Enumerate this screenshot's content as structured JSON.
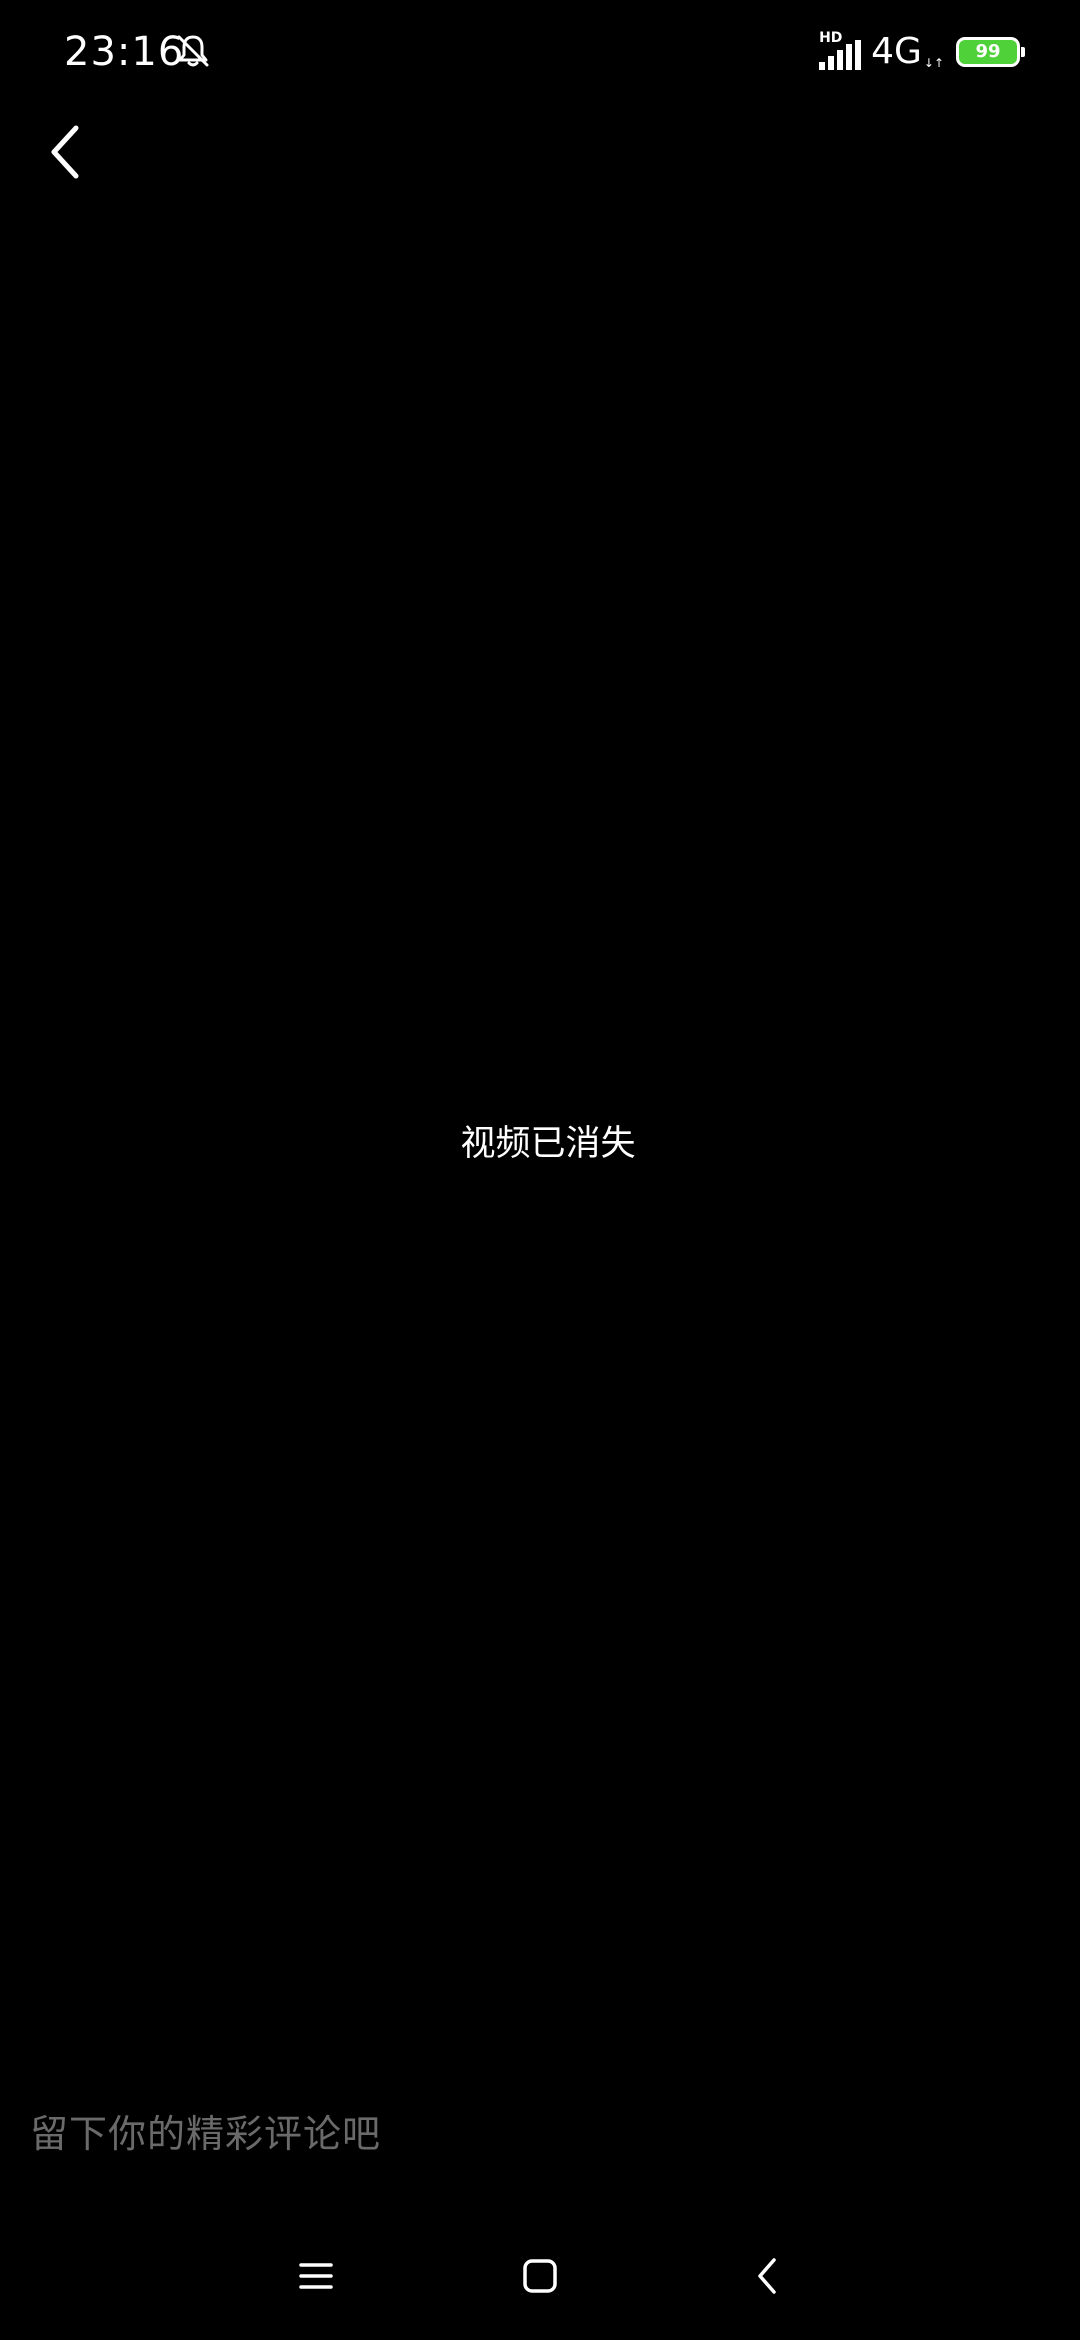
{
  "status_bar": {
    "time": "23:16",
    "hd_label": "HD",
    "network": "4G",
    "network_arrows": "↓↑",
    "battery_level": "99",
    "battery_color": "#4fd13a",
    "icons": [
      "bell-off-icon",
      "signal-icon",
      "battery-icon"
    ]
  },
  "header": {
    "back_icon": "chevron-left-icon"
  },
  "main": {
    "message": "视频已消失"
  },
  "comment": {
    "placeholder": "留下你的精彩评论吧"
  },
  "system_nav": {
    "icons": [
      "menu-icon",
      "home-icon",
      "back-icon"
    ]
  }
}
